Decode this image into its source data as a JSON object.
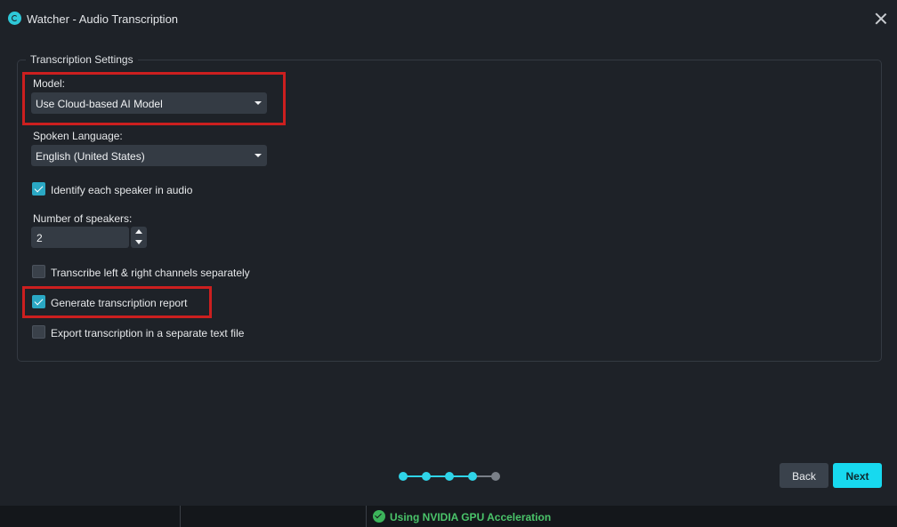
{
  "window": {
    "title": "Watcher - Audio Transcription",
    "icon": "watcher-app-icon",
    "close_icon": "close-icon"
  },
  "settings": {
    "group_title": "Transcription Settings",
    "model": {
      "label": "Model:",
      "selected": "Use Cloud-based AI Model"
    },
    "language": {
      "label": "Spoken Language:",
      "selected": "English (United States)"
    },
    "identify_speakers": {
      "label": "Identify each speaker in audio",
      "checked": true
    },
    "num_speakers": {
      "label": "Number of speakers:",
      "value": "2"
    },
    "separate_channels": {
      "label": "Transcribe left & right channels separately",
      "checked": false
    },
    "generate_report": {
      "label": "Generate transcription report",
      "checked": true
    },
    "export_text": {
      "label": "Export transcription in a separate text file",
      "checked": false
    }
  },
  "wizard": {
    "total_steps": 5,
    "completed_steps": 4,
    "back_label": "Back",
    "next_label": "Next"
  },
  "status": {
    "gpu_text": "Using NVIDIA GPU Acceleration",
    "gpu_icon": "check-circle-icon"
  },
  "colors": {
    "accent": "#17d9ef",
    "highlight": "#cc1f1f",
    "status_ok": "#4ac46a",
    "background": "#1e2228"
  }
}
